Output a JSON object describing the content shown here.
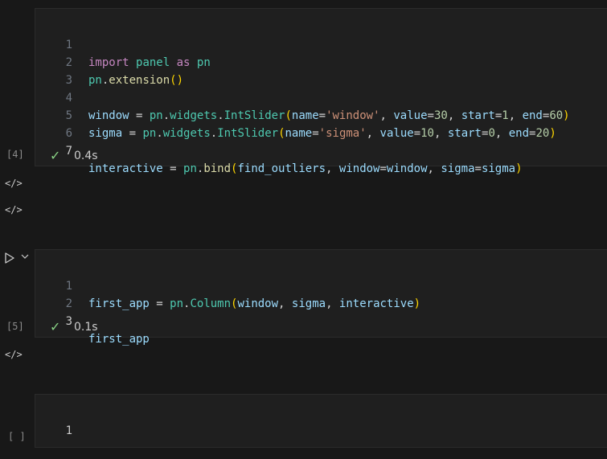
{
  "cells": [
    {
      "exec_count": "[4]",
      "time": "0.4s",
      "line_numbers": [
        "1",
        "2",
        "3",
        "4",
        "5",
        "6",
        "7"
      ],
      "lines": {
        "l1": [
          "import",
          " ",
          "panel",
          " ",
          "as",
          " ",
          "pn"
        ],
        "l2": [
          "pn",
          ".",
          "extension",
          "(",
          ")"
        ],
        "l4": [
          "window",
          " = ",
          "pn",
          ".",
          "widgets",
          ".",
          "IntSlider",
          "(",
          "name",
          "=",
          "'window'",
          ", ",
          "value",
          "=",
          "30",
          ", ",
          "start",
          "=",
          "1",
          ", ",
          "end",
          "=",
          "60",
          ")"
        ],
        "l5": [
          "sigma",
          " = ",
          "pn",
          ".",
          "widgets",
          ".",
          "IntSlider",
          "(",
          "name",
          "=",
          "'sigma'",
          ", ",
          "value",
          "=",
          "10",
          ", ",
          "start",
          "=",
          "0",
          ", ",
          "end",
          "=",
          "20",
          ")"
        ],
        "l7": [
          "interactive",
          " = ",
          "pn",
          ".",
          "bind",
          "(",
          "find_outliers",
          ", ",
          "window",
          "=",
          "window",
          ", ",
          "sigma",
          "=",
          "sigma",
          ")"
        ]
      }
    },
    {
      "exec_count": "[5]",
      "time": "0.1s",
      "line_numbers": [
        "1",
        "2",
        "3"
      ],
      "lines": {
        "l1": [
          "first_app",
          " = ",
          "pn",
          ".",
          "Column",
          "(",
          "window",
          ", ",
          "sigma",
          ", ",
          "interactive",
          ")"
        ],
        "l3": [
          "first_app"
        ]
      }
    },
    {
      "exec_count": "[ ]",
      "line_numbers": [
        "1"
      ]
    }
  ],
  "icons": {
    "code_output": "</>",
    "run": "▷",
    "chevron": "⌄",
    "check": "✓"
  }
}
